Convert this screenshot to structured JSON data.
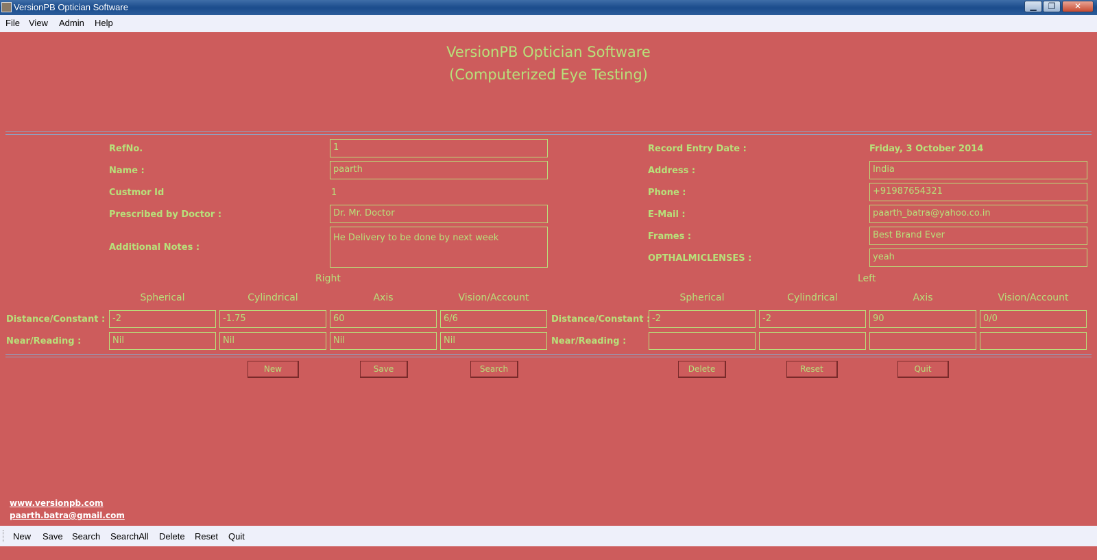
{
  "window": {
    "title": "VersionPB Optician Software",
    "controls": {
      "minimize": "▁",
      "maximize": "❐",
      "close": "✕"
    }
  },
  "menu": [
    "File",
    "View",
    "Admin",
    "Help"
  ],
  "header": {
    "title": "VersionPB Optician Software\n(Computerized Eye Testing)"
  },
  "form": {
    "left": {
      "refno_label": "RefNo.",
      "refno_value": "1",
      "name_label": "Name :",
      "name_value": "paarth",
      "customer_id_label": "Custmor Id",
      "customer_id_value": "1",
      "doctor_label": "Prescribed by Doctor :",
      "doctor_value": "Dr. Mr. Doctor",
      "notes_label": "Additional Notes :",
      "notes_value": "He Delivery to be done by next week"
    },
    "right": {
      "date_label": "Record Entry Date :",
      "date_value": "Friday, 3 October 2014",
      "address_label": "Address :",
      "address_value": "India",
      "phone_label": "Phone :",
      "phone_value": "+91987654321",
      "email_label": "E-Mail :",
      "email_value": "paarth_batra@yahoo.co.in",
      "frames_label": "Frames :",
      "frames_value": "Best Brand Ever",
      "lenses_label": "OPTHALMICLENSES :",
      "lenses_value": "yeah"
    }
  },
  "prescription": {
    "right_title": "Right",
    "left_title": "Left",
    "columns": [
      "Spherical",
      "Cylindrical",
      "Axis",
      "Vision/Account"
    ],
    "rows": {
      "distance_label": "Distance/Constant :",
      "near_label": "Near/Reading :"
    },
    "right_eye": {
      "distance": [
        "-2",
        "-1.75",
        "60",
        "6/6"
      ],
      "near": [
        "Nil",
        "Nil",
        "Nil",
        "Nil"
      ]
    },
    "left_eye": {
      "distance": [
        "-2",
        "-2",
        "90",
        "0/0"
      ],
      "near": [
        "",
        "",
        "",
        ""
      ]
    }
  },
  "actions": {
    "new": "New",
    "save": "Save",
    "search": "Search",
    "delete": "Delete",
    "reset": "Reset",
    "quit": "Quit"
  },
  "links": {
    "website": "www.versionpb.com",
    "email": "paarth.batra@gmail.com"
  },
  "toolbar": [
    "New",
    "Save",
    "Search",
    "SearchAll",
    "Delete",
    "Reset",
    "Quit"
  ],
  "colors": {
    "background": "#cd5c5c",
    "accent_text": "#b8e07a",
    "chrome": "#eef0fa",
    "titlebar": "#1b4c8c"
  }
}
